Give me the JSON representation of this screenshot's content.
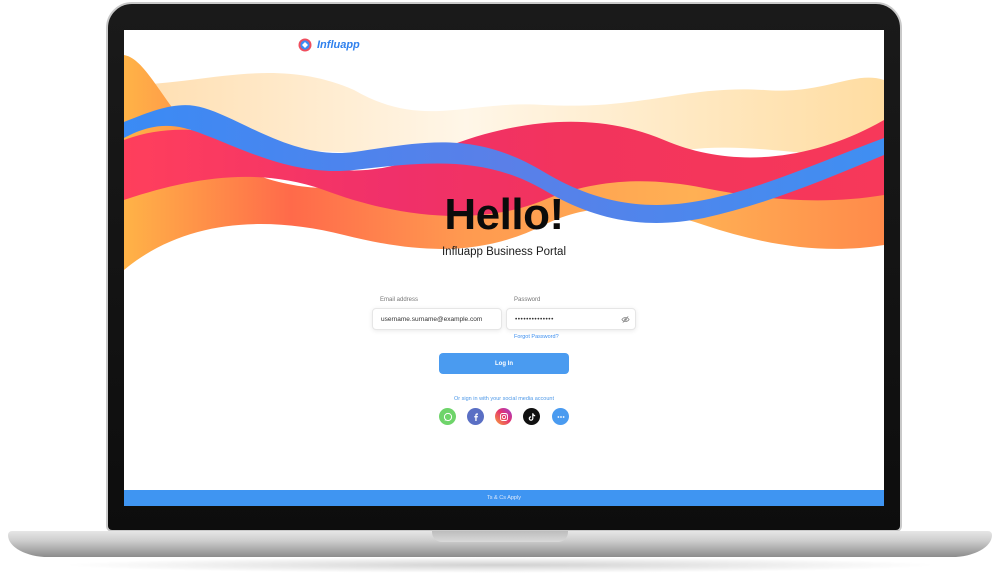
{
  "brand": {
    "name": "Influapp"
  },
  "hero": {
    "title": "Hello!",
    "subtitle": "Influapp Business Portal"
  },
  "form": {
    "email": {
      "label": "Email address",
      "value": "username.surname@example.com"
    },
    "password": {
      "label": "Password",
      "value": "••••••••••••••"
    },
    "forgot_link": "Forgot Password?",
    "login_button": "Log In"
  },
  "social": {
    "caption": "Or sign in with your social media account",
    "buttons": [
      {
        "name": "whatsapp",
        "icon": "whatsapp-icon",
        "color": "#6ed46a"
      },
      {
        "name": "facebook",
        "icon": "facebook-icon",
        "color": "#5a6fc4"
      },
      {
        "name": "instagram",
        "icon": "instagram-icon",
        "color": "#d6339a"
      },
      {
        "name": "tiktok",
        "icon": "tiktok-icon",
        "color": "#111111"
      },
      {
        "name": "more",
        "icon": "more-icon",
        "color": "#4a9bf0"
      }
    ]
  },
  "footer": {
    "text": "Ts & Cs Apply"
  },
  "colors": {
    "accent": "#4a9bf0",
    "wave_blue": "#4a8ff0",
    "wave_red": "#f0306a",
    "wave_orange": "#ffa845"
  }
}
